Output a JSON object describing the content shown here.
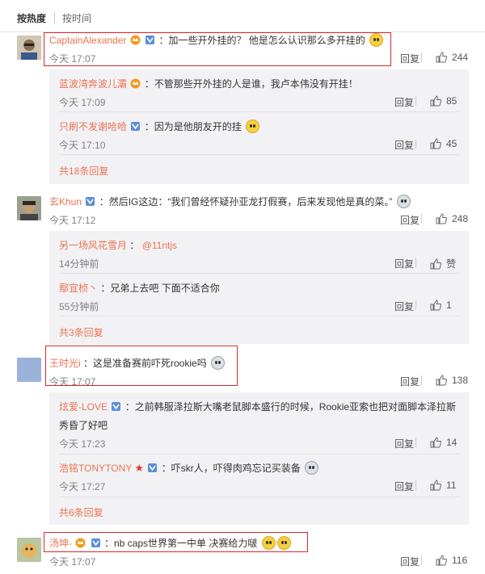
{
  "sort": {
    "hot": "按热度",
    "time": "按时间"
  },
  "reply_label": "回复",
  "comments": [
    {
      "user": "CaptainAlexander",
      "text": "：加一些开外挂的？ 他是怎么认识那么多开挂的",
      "time": "今天 17:07",
      "likes": "244",
      "replies": [
        {
          "user": "蓝波湾奔波儿灞",
          "text": "：不管那些开外挂的人是谁，我卢本伟没有开挂！",
          "time": "今天 17:09",
          "likes": "85"
        },
        {
          "user": "只刷不发谢哈哈",
          "text": "：因为是他朋友开的挂",
          "time": "今天 17:10",
          "likes": "45"
        }
      ],
      "more": "共18条回复"
    },
    {
      "user": "玄Khun",
      "text": "：然后IG这边：“我们曾经怀疑孙亚龙打假赛，后来发现他是真的菜。”",
      "time": "今天 17:12",
      "likes": "248",
      "replies": [
        {
          "user": "另一场风花雪月",
          "text": "：",
          "mention": "@11ntjs",
          "time": "14分钟前",
          "likes": "赞"
        },
        {
          "user": "鄢宜桢丶",
          "text": "：兄弟上去吧 下面不适合你",
          "time": "55分钟前",
          "likes": "1"
        }
      ],
      "more": "共3条回复"
    },
    {
      "user": "王时光i",
      "text": "：这是准备赛前吓死rookie吗",
      "time": "今天 17:07",
      "likes": "138",
      "replies": [
        {
          "user": "炫爱-LOVE",
          "text": "：之前韩服泽拉斯大嘴老鼠脚本盛行的时候，Rookie亚索也把对面脚本泽拉斯",
          "text2": "秀昏了好吧",
          "time": "今天 17:23",
          "likes": "14"
        },
        {
          "user": "浩铭TONYTONY",
          "text": "：吓skr人，吓得肉鸡忘记买装备",
          "time": "今天 17:27",
          "likes": "11"
        }
      ],
      "more": "共6条回复"
    },
    {
      "user": "汤坤-",
      "text": "：nb caps世界第一中单 决赛给力啵",
      "time": "今天 17:07",
      "likes": "116"
    }
  ],
  "colors": {
    "username": "#eb7350",
    "highlight": "#d9282c",
    "reply_bg": "#f2f2f5"
  }
}
